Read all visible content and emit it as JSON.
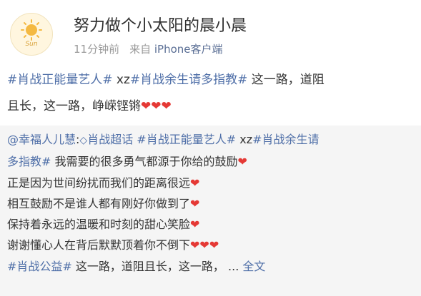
{
  "header": {
    "username": "努力做个小太阳的晨小晨",
    "avatar_text": "Sun",
    "time": "11分钟前",
    "source_prefix": "来自",
    "source": "iPhone客户端"
  },
  "content": {
    "tag1": "#肖战正能量艺人#",
    "text1": "xz",
    "tag2": "#肖战余生请多指教#",
    "text2": "这一路，道阻",
    "line2": "且长，这一路，峥嵘铿锵",
    "hearts": "❤❤❤"
  },
  "repost": {
    "mention": "@幸福人儿慧",
    "super_icon": "◇",
    "supertopic": "肖战超话",
    "tag1": "#肖战正能量艺人#",
    "text1": "xz",
    "tag2a": "#肖战余生请",
    "tag2b": "多指教#",
    "line1_rest": "我需要的很多勇气都源于你给的鼓励",
    "heart1": "❤",
    "line2": "正是因为世间纷扰而我们的距离很远",
    "heart2": "❤",
    "line3": "相互鼓励不是谁人都有刚好你做到了",
    "heart3": "❤",
    "line4": "保持着永远的温暖和时刻的甜心笑脸",
    "heart4": "❤",
    "line5": "谢谢懂心人在背后默默顶着你不倒下",
    "hearts5": "❤❤❤",
    "tag3": "#肖战公益#",
    "line6_rest": "这一路，道阻且长，这一路，",
    "ellipsis": "...",
    "full_text": "全文"
  },
  "colors": {
    "link": "#4f6fa8",
    "heart": "#e53935",
    "repost_bg": "#f5f5f5",
    "meta": "#9a9a9a"
  }
}
